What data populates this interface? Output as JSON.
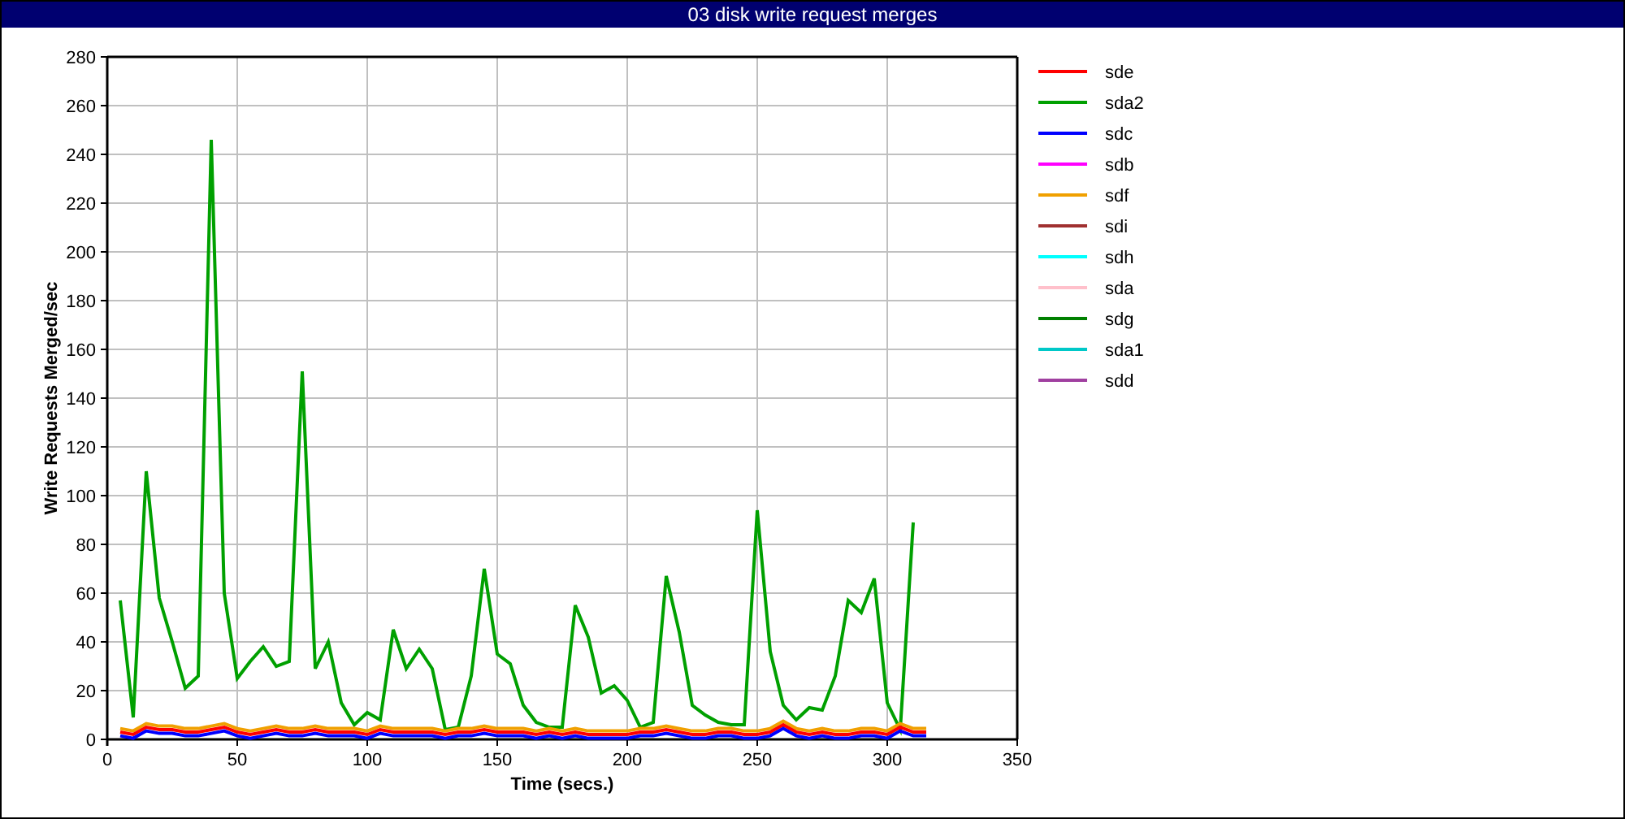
{
  "window": {
    "title": "03 disk write request merges"
  },
  "chart": {
    "chart_data": {
      "type": "line",
      "xlabel": "Time (secs.)",
      "ylabel": "Write Requests Merged/sec",
      "xlim": [
        0,
        350
      ],
      "ylim": [
        0,
        280
      ],
      "grid": true,
      "legend": "right",
      "xticks": [
        0,
        50,
        100,
        150,
        200,
        250,
        300,
        350
      ],
      "yticks": [
        0,
        20,
        40,
        60,
        80,
        100,
        120,
        140,
        160,
        180,
        200,
        220,
        240,
        260,
        280
      ],
      "x": [
        5,
        10,
        15,
        20,
        25,
        30,
        35,
        40,
        45,
        50,
        55,
        60,
        65,
        70,
        75,
        80,
        85,
        90,
        95,
        100,
        105,
        110,
        115,
        120,
        125,
        130,
        135,
        140,
        145,
        150,
        155,
        160,
        165,
        170,
        175,
        180,
        185,
        190,
        195,
        200,
        205,
        210,
        215,
        220,
        225,
        230,
        235,
        240,
        245,
        250,
        255,
        260,
        265,
        270,
        275,
        280,
        285,
        290,
        295,
        300,
        305,
        310,
        315
      ],
      "series": [
        {
          "name": "sde",
          "color": "#ff0000",
          "values": [
            3,
            2,
            5,
            4,
            4,
            3,
            3,
            4,
            5,
            3,
            2,
            3,
            4,
            3,
            3,
            4,
            3,
            3,
            3,
            2,
            4,
            3,
            3,
            3,
            3,
            2,
            3,
            3,
            4,
            3,
            3,
            3,
            2,
            3,
            2,
            3,
            2,
            2,
            2,
            2,
            3,
            3,
            4,
            3,
            2,
            2,
            3,
            3,
            2,
            2,
            3,
            6,
            3,
            2,
            3,
            2,
            2,
            3,
            3,
            2,
            5,
            3,
            3
          ]
        },
        {
          "name": "sda2",
          "color": "#00a000",
          "values": [
            57,
            9,
            110,
            58,
            40,
            21,
            26,
            246,
            60,
            25,
            32,
            38,
            30,
            32,
            151,
            29,
            40,
            15,
            6,
            11,
            8,
            45,
            29,
            37,
            29,
            4,
            5,
            26,
            70,
            35,
            31,
            14,
            7,
            5,
            5,
            55,
            42,
            19,
            22,
            16,
            5,
            7,
            67,
            44,
            14,
            10,
            7,
            6,
            6,
            94,
            36,
            14,
            8,
            13,
            12,
            26,
            57,
            52,
            66,
            15,
            4,
            89,
            null
          ]
        },
        {
          "name": "sdc",
          "color": "#0000ff",
          "values": [
            1.5,
            0.5,
            3.5,
            2.5,
            2.5,
            1.5,
            1.5,
            2.5,
            3.5,
            1.5,
            0.5,
            1.5,
            2.5,
            1.5,
            1.5,
            2.5,
            1.5,
            1.5,
            1.5,
            0.5,
            2.5,
            1.5,
            1.5,
            1.5,
            1.5,
            0.5,
            1.5,
            1.5,
            2.5,
            1.5,
            1.5,
            1.5,
            0.5,
            1.5,
            0.5,
            1.5,
            0.5,
            0.5,
            0.5,
            0.5,
            1.5,
            1.5,
            2.5,
            1.5,
            0.5,
            0.5,
            1.5,
            1.5,
            0.5,
            0.5,
            1.5,
            4.5,
            1.5,
            0.5,
            1.5,
            0.5,
            0.5,
            1.5,
            1.5,
            0.5,
            3.5,
            1.5,
            1.5
          ]
        },
        {
          "name": "sdb",
          "color": "#ff00ff",
          "values": [
            null,
            null,
            null,
            null,
            null,
            null,
            null,
            null,
            null,
            null,
            null,
            null,
            null,
            null,
            null,
            null,
            null,
            null,
            null,
            null,
            null,
            null,
            null,
            null,
            null,
            null,
            null,
            null,
            null,
            null,
            null,
            null,
            null,
            null,
            null,
            null,
            null,
            null,
            null,
            null,
            null,
            null,
            null,
            null,
            null,
            null,
            null,
            null,
            null,
            null,
            null,
            null,
            null,
            null,
            null,
            null,
            null,
            null,
            null,
            null,
            null,
            null,
            null
          ]
        },
        {
          "name": "sdf",
          "color": "#f0a000",
          "values": [
            4.5,
            3.5,
            6.5,
            5.5,
            5.5,
            4.5,
            4.5,
            5.5,
            6.5,
            4.5,
            3.5,
            4.5,
            5.5,
            4.5,
            4.5,
            5.5,
            4.5,
            4.5,
            4.5,
            3.5,
            5.5,
            4.5,
            4.5,
            4.5,
            4.5,
            3.5,
            4.5,
            4.5,
            5.5,
            4.5,
            4.5,
            4.5,
            3.5,
            4.5,
            3.5,
            4.5,
            3.5,
            3.5,
            3.5,
            3.5,
            4.5,
            4.5,
            5.5,
            4.5,
            3.5,
            3.5,
            4.5,
            4.5,
            3.5,
            3.5,
            4.5,
            7.5,
            4.5,
            3.5,
            4.5,
            3.5,
            3.5,
            4.5,
            4.5,
            3.5,
            6.5,
            4.5,
            4.5
          ]
        },
        {
          "name": "sdi",
          "color": "#a03030",
          "values": [
            null,
            null,
            null,
            null,
            null,
            null,
            null,
            null,
            null,
            null,
            null,
            null,
            null,
            null,
            null,
            null,
            null,
            null,
            null,
            null,
            null,
            null,
            null,
            null,
            null,
            null,
            null,
            null,
            null,
            null,
            null,
            null,
            null,
            null,
            null,
            null,
            null,
            null,
            null,
            null,
            null,
            null,
            null,
            null,
            null,
            null,
            null,
            null,
            null,
            null,
            null,
            null,
            null,
            null,
            null,
            null,
            null,
            null,
            null,
            null,
            null,
            null,
            null
          ]
        },
        {
          "name": "sdh",
          "color": "#00ffff",
          "values": [
            null,
            null,
            null,
            null,
            null,
            null,
            null,
            null,
            null,
            null,
            null,
            null,
            null,
            null,
            null,
            null,
            null,
            null,
            null,
            null,
            null,
            null,
            null,
            null,
            null,
            null,
            null,
            null,
            null,
            null,
            null,
            null,
            null,
            null,
            null,
            null,
            null,
            null,
            null,
            null,
            null,
            null,
            null,
            null,
            null,
            null,
            null,
            null,
            null,
            null,
            null,
            null,
            null,
            null,
            null,
            null,
            null,
            null,
            null,
            null,
            null,
            null,
            null
          ]
        },
        {
          "name": "sda",
          "color": "#ffc0cb",
          "values": [
            null,
            null,
            null,
            null,
            null,
            null,
            null,
            null,
            null,
            null,
            null,
            null,
            null,
            null,
            null,
            null,
            null,
            null,
            null,
            null,
            null,
            null,
            null,
            null,
            null,
            null,
            null,
            null,
            null,
            null,
            null,
            null,
            null,
            null,
            null,
            null,
            null,
            null,
            null,
            null,
            null,
            null,
            null,
            null,
            null,
            null,
            null,
            null,
            null,
            null,
            null,
            null,
            null,
            null,
            null,
            null,
            null,
            null,
            null,
            null,
            null,
            null,
            null
          ]
        },
        {
          "name": "sdg",
          "color": "#008000",
          "values": [
            null,
            null,
            null,
            null,
            null,
            null,
            null,
            null,
            null,
            null,
            null,
            null,
            null,
            null,
            null,
            null,
            null,
            null,
            null,
            null,
            null,
            null,
            null,
            null,
            null,
            null,
            null,
            null,
            null,
            null,
            null,
            null,
            null,
            null,
            null,
            null,
            null,
            null,
            null,
            null,
            null,
            null,
            null,
            null,
            null,
            null,
            null,
            null,
            null,
            null,
            null,
            null,
            null,
            null,
            null,
            null,
            null,
            null,
            null,
            null,
            null,
            null,
            null
          ]
        },
        {
          "name": "sda1",
          "color": "#00c8c8",
          "values": [
            null,
            null,
            null,
            null,
            null,
            null,
            null,
            null,
            null,
            null,
            null,
            null,
            null,
            null,
            null,
            null,
            null,
            null,
            null,
            null,
            null,
            null,
            null,
            null,
            null,
            null,
            null,
            null,
            null,
            null,
            null,
            null,
            null,
            null,
            null,
            null,
            null,
            null,
            null,
            null,
            null,
            null,
            null,
            null,
            null,
            null,
            null,
            null,
            null,
            null,
            null,
            null,
            null,
            null,
            null,
            null,
            null,
            null,
            null,
            null,
            null,
            null,
            null
          ]
        },
        {
          "name": "sdd",
          "color": "#a040a0",
          "values": [
            null,
            null,
            null,
            null,
            null,
            null,
            null,
            null,
            null,
            null,
            null,
            null,
            null,
            null,
            null,
            null,
            null,
            null,
            null,
            null,
            null,
            null,
            null,
            null,
            null,
            null,
            null,
            null,
            null,
            null,
            null,
            null,
            null,
            null,
            null,
            null,
            null,
            null,
            null,
            null,
            null,
            null,
            null,
            null,
            null,
            null,
            null,
            null,
            null,
            null,
            null,
            null,
            null,
            null,
            null,
            null,
            null,
            null,
            null,
            null,
            null,
            null,
            null
          ]
        }
      ]
    }
  }
}
